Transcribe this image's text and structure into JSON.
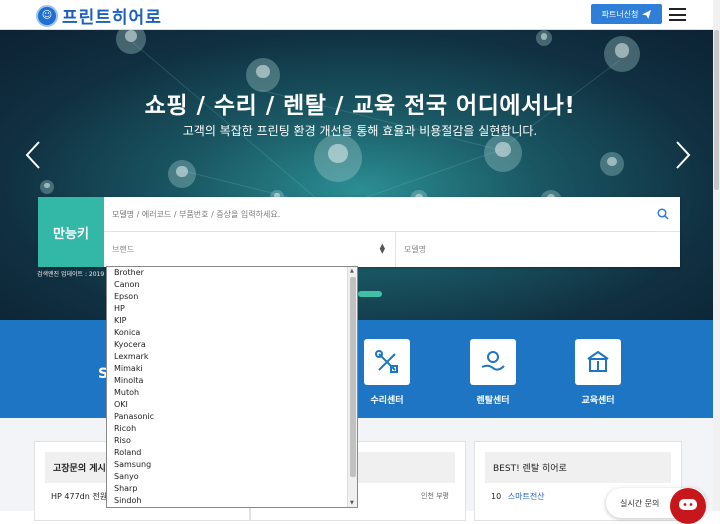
{
  "header": {
    "logo_text": "프린트히어로",
    "partner_button": "파트너신청"
  },
  "hero": {
    "title": "쇼핑 / 수리 / 렌탈 / 교육 전국 어디에서나!",
    "subtitle": "고객의 복잡한 프린팅 환경 개선을 통해 효율과 비용절감을 실현합니다."
  },
  "search": {
    "tab_label": "만능키",
    "placeholder": "모델명 / 에러코드 / 부품번호 / 증상을 입력하세요.",
    "brand_placeholder": "브랜드",
    "model_placeholder": "모델명",
    "update_note": "검색엔진 업데이트 : 2019"
  },
  "brand_options": [
    "Brother",
    "Canon",
    "Epson",
    "HP",
    "KIP",
    "Konica",
    "Kyocera",
    "Lexmark",
    "Mimaki",
    "Minolta",
    "Mutoh",
    "OKI",
    "Panasonic",
    "Ricoh",
    "Riso",
    "Roland",
    "Samsung",
    "Sanyo",
    "Sharp",
    "Sindoh"
  ],
  "services": {
    "partial_letter": "S",
    "items": [
      {
        "label": "수리센터",
        "icon": "wrench-screwdriver-icon"
      },
      {
        "label": "렌탈센터",
        "icon": "hand-coin-icon"
      },
      {
        "label": "교육센터",
        "icon": "book-house-icon"
      }
    ]
  },
  "lower": {
    "panel_left_title": "고장문의 게시",
    "panel_left_row": "HP 477dn 전원이",
    "panel_mid_meta": "인천 부평",
    "panel_right_title": "BEST! 렌탈 히어로",
    "panel_right_rank": "10",
    "panel_right_name": "스마트전산",
    "chat_label": "실시간 문의"
  },
  "colors": {
    "brand_blue": "#1d75c3",
    "accent_teal": "#33b8a8",
    "chat_red": "#c8161d"
  }
}
